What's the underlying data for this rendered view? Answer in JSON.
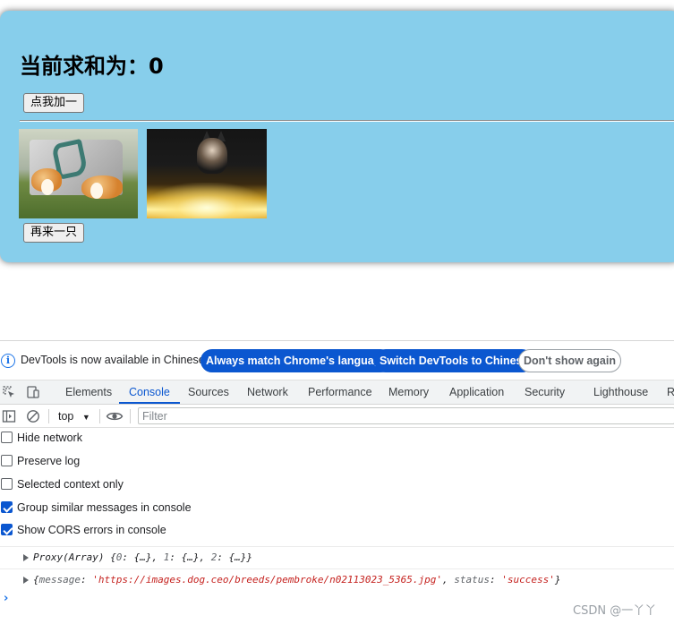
{
  "app": {
    "sum_label": "当前求和为：0",
    "add_button": "点我加一",
    "more_button": "再来一只",
    "images": [
      {
        "alt": "two corgis in front of a stone"
      },
      {
        "alt": "corgi on a lit floor"
      }
    ]
  },
  "devtools": {
    "infobar": {
      "message": "DevTools is now available in Chinese!",
      "btn_match": "Always match Chrome's language",
      "btn_switch": "Switch DevTools to Chinese",
      "btn_dismiss": "Don't show again"
    },
    "tabs": [
      "Elements",
      "Console",
      "Sources",
      "Network",
      "Performance",
      "Memory",
      "Application",
      "Security",
      "Lighthouse",
      "R"
    ],
    "active_tab": "Console",
    "context": "top",
    "filter_placeholder": "Filter",
    "settings": [
      {
        "label": "Hide network",
        "checked": false
      },
      {
        "label": "Preserve log",
        "checked": false
      },
      {
        "label": "Selected context only",
        "checked": false
      },
      {
        "label": "Group similar messages in console",
        "checked": true
      },
      {
        "label": "Show CORS errors in console",
        "checked": true
      }
    ],
    "logs": {
      "line1": {
        "prefix": "Proxy(Array) {",
        "k0": "0",
        "v0": ": {…}, ",
        "k1": "1",
        "v1": ": {…}, ",
        "k2": "2",
        "v2": ": {…}}"
      },
      "line2": {
        "open": "{",
        "key_message": "message",
        "colon1": ": ",
        "message_value": "'https://images.dog.ceo/breeds/pembroke/n02113023_5365.jpg'",
        "comma": ", ",
        "key_status": "status",
        "colon2": ": ",
        "status_value": "'success'",
        "close": "}"
      }
    },
    "prompt_symbol": "›"
  },
  "watermark": "CSDN @一丫丫",
  "colors": {
    "card_bg": "#87ceeb",
    "accent_blue": "#0b57d0",
    "string_red": "#c5221f"
  }
}
